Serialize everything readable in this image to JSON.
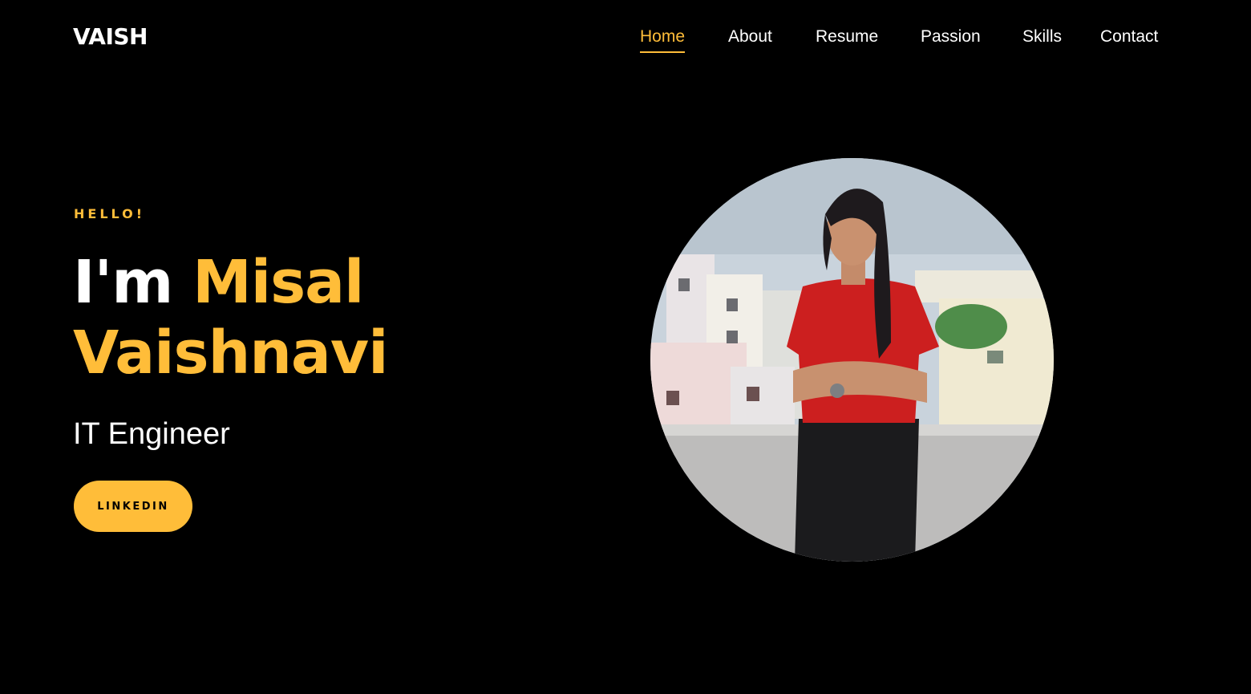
{
  "brand": {
    "name": "VAISH"
  },
  "nav": {
    "items": [
      {
        "label": "Home",
        "active": true
      },
      {
        "label": "About",
        "active": false
      },
      {
        "label": "Resume",
        "active": false
      },
      {
        "label": "Passion",
        "active": false
      },
      {
        "label": "Skills",
        "active": false
      },
      {
        "label": "Contact",
        "active": false
      }
    ]
  },
  "hero": {
    "greeting": "HELLO!",
    "intro": "I'm",
    "name_line1": "Misal",
    "name_line2": "Vaishnavi",
    "role": "IT Engineer",
    "cta_label": "LINKEDIN",
    "portrait": "profile-photo"
  },
  "colors": {
    "background": "#000000",
    "accent": "#ffbd39",
    "text": "#ffffff"
  }
}
